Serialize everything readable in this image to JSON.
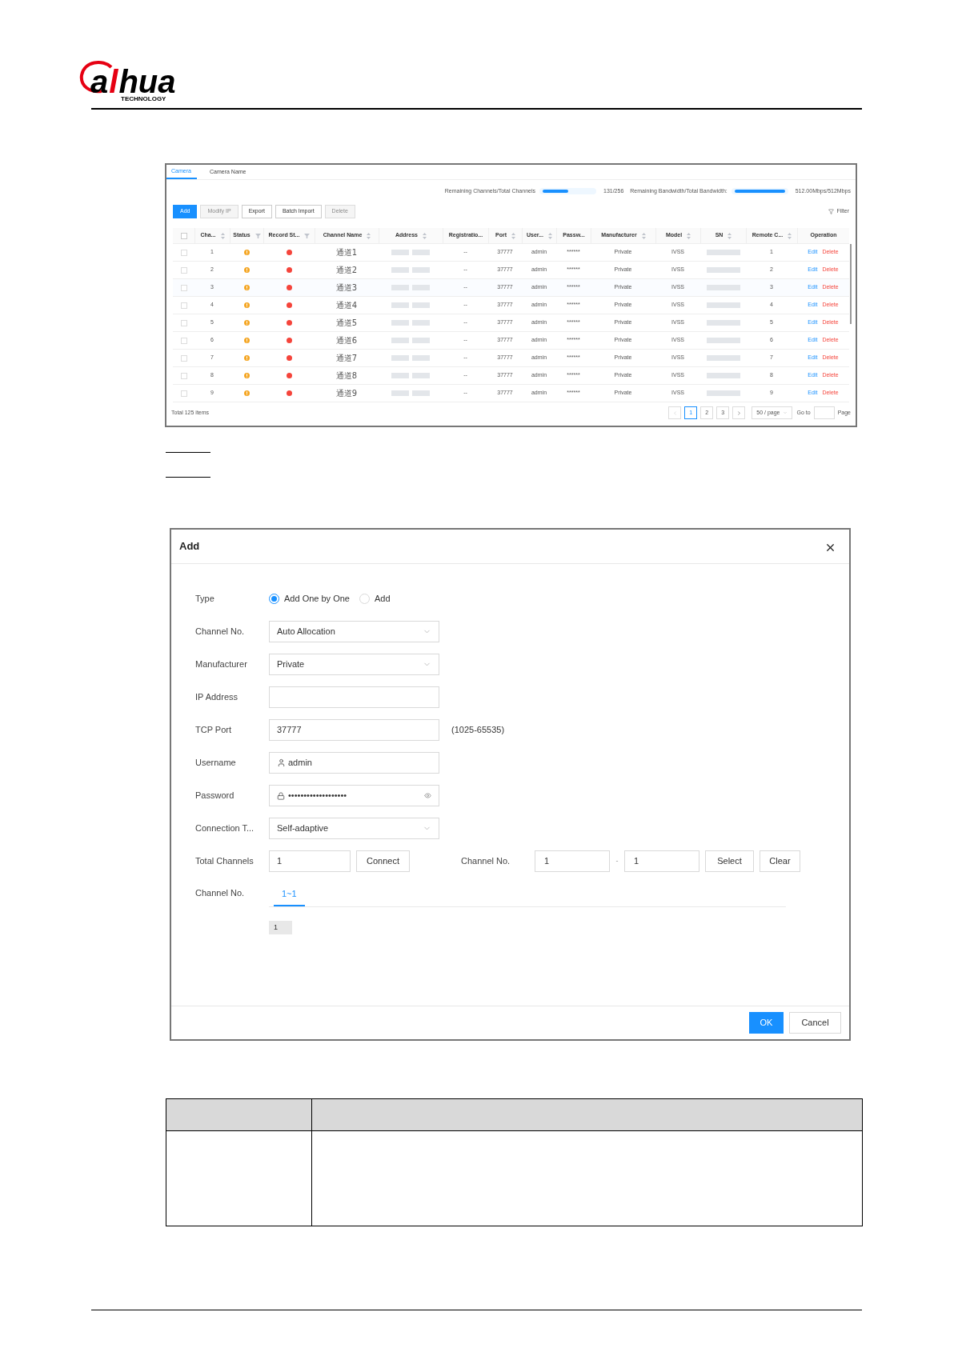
{
  "logo": {
    "parts": [
      {
        "text": "a",
        "kind": "ring"
      },
      {
        "text": "l",
        "kind": "slash"
      },
      {
        "text": "hua",
        "kind": "plain"
      }
    ],
    "tagline": "TECHNOLOGY"
  },
  "camera_screen": {
    "tabs": [
      {
        "label": "Camera",
        "selected": true
      },
      {
        "label": "Camera Name",
        "selected": false
      }
    ],
    "meters": [
      {
        "label": "Remaining Channels/Total Channels",
        "level": 0.51,
        "reading": "131/256"
      },
      {
        "label": "Remaining Bandwidth/Total Bandwidth:",
        "level": 1,
        "reading": "512.00Mbps/512Mbps"
      }
    ],
    "toolbar": [
      {
        "label": "Add",
        "kind": "primary",
        "disabled": false
      },
      {
        "label": "Modify IP",
        "kind": "default",
        "disabled": true
      },
      {
        "label": "Export",
        "kind": "default",
        "disabled": false
      },
      {
        "label": "Batch Import",
        "kind": "default",
        "disabled": false
      },
      {
        "label": "Delete",
        "kind": "default",
        "disabled": true
      }
    ],
    "filter": "Filter",
    "table": {
      "select_all": false,
      "columns": [
        {
          "label": "Cha...",
          "kind": "sort"
        },
        {
          "label": "Status",
          "kind": "filter"
        },
        {
          "label": "Record St...",
          "kind": "filter"
        },
        {
          "label": "Channel Name",
          "kind": "sort"
        },
        {
          "label": "Address",
          "kind": "sort"
        },
        {
          "label": "Registratio...",
          "kind": "none"
        },
        {
          "label": "Port",
          "kind": "sort"
        },
        {
          "label": "User...",
          "kind": "sort"
        },
        {
          "label": "Passw...",
          "kind": "none"
        },
        {
          "label": "Manufacturer",
          "kind": "sort"
        },
        {
          "label": "Model",
          "kind": "sort"
        },
        {
          "label": "SN",
          "kind": "sort"
        },
        {
          "label": "Remote C...",
          "kind": "sort"
        },
        {
          "label": "Operation",
          "kind": "none"
        }
      ],
      "rows": [
        {
          "checked": false,
          "channel": "1",
          "name": "通道1",
          "registration": "--",
          "port": "37777",
          "user": "admin",
          "password": "******",
          "manufacturer": "Private",
          "model": "IVSS",
          "remote": "1",
          "actions": [
            {
              "label": "Edit",
              "kind": "edit"
            },
            {
              "label": "Delete",
              "kind": "delete"
            }
          ]
        },
        {
          "checked": false,
          "channel": "2",
          "name": "通道2",
          "registration": "--",
          "port": "37777",
          "user": "admin",
          "password": "******",
          "manufacturer": "Private",
          "model": "IVSS",
          "remote": "2",
          "actions": [
            {
              "label": "Edit",
              "kind": "edit"
            },
            {
              "label": "Delete",
              "kind": "delete"
            }
          ]
        },
        {
          "checked": false,
          "channel": "3",
          "name": "通道3",
          "registration": "--",
          "port": "37777",
          "user": "admin",
          "password": "******",
          "manufacturer": "Private",
          "model": "IVSS",
          "remote": "3",
          "actions": [
            {
              "label": "Edit",
              "kind": "edit"
            },
            {
              "label": "Delete",
              "kind": "delete"
            }
          ]
        },
        {
          "checked": false,
          "channel": "4",
          "name": "通道4",
          "registration": "--",
          "port": "37777",
          "user": "admin",
          "password": "******",
          "manufacturer": "Private",
          "model": "IVSS",
          "remote": "4",
          "actions": [
            {
              "label": "Edit",
              "kind": "edit"
            },
            {
              "label": "Delete",
              "kind": "delete"
            }
          ]
        },
        {
          "checked": false,
          "channel": "5",
          "name": "通道5",
          "registration": "--",
          "port": "37777",
          "user": "admin",
          "password": "******",
          "manufacturer": "Private",
          "model": "IVSS",
          "remote": "5",
          "actions": [
            {
              "label": "Edit",
              "kind": "edit"
            },
            {
              "label": "Delete",
              "kind": "delete"
            }
          ]
        },
        {
          "checked": false,
          "channel": "6",
          "name": "通道6",
          "registration": "--",
          "port": "37777",
          "user": "admin",
          "password": "******",
          "manufacturer": "Private",
          "model": "IVSS",
          "remote": "6",
          "actions": [
            {
              "label": "Edit",
              "kind": "edit"
            },
            {
              "label": "Delete",
              "kind": "delete"
            }
          ]
        },
        {
          "checked": false,
          "channel": "7",
          "name": "通道7",
          "registration": "--",
          "port": "37777",
          "user": "admin",
          "password": "******",
          "manufacturer": "Private",
          "model": "IVSS",
          "remote": "7",
          "actions": [
            {
              "label": "Edit",
              "kind": "edit"
            },
            {
              "label": "Delete",
              "kind": "delete"
            }
          ]
        },
        {
          "checked": false,
          "channel": "8",
          "name": "通道8",
          "registration": "--",
          "port": "37777",
          "user": "admin",
          "password": "******",
          "manufacturer": "Private",
          "model": "IVSS",
          "remote": "8",
          "actions": [
            {
              "label": "Edit",
              "kind": "edit"
            },
            {
              "label": "Delete",
              "kind": "delete"
            }
          ]
        },
        {
          "checked": false,
          "channel": "9",
          "name": "通道9",
          "registration": "--",
          "port": "37777",
          "user": "admin",
          "password": "******",
          "manufacturer": "Private",
          "model": "IVSS",
          "remote": "9",
          "actions": [
            {
              "label": "Edit",
              "kind": "edit"
            },
            {
              "label": "Delete",
              "kind": "delete"
            }
          ]
        }
      ]
    },
    "total": "Total 125 items",
    "pagination": {
      "prev_disabled": true,
      "pages": [
        {
          "label": "1",
          "selected": true
        },
        {
          "label": "2",
          "selected": false
        },
        {
          "label": "3",
          "selected": false
        }
      ],
      "page_size": "50 / page",
      "goto_label": "Go to",
      "page_label": "Page"
    }
  },
  "add_dialog": {
    "title": "Add",
    "fields": [
      {
        "label": "Type",
        "kind": "radio",
        "options": [
          {
            "label": "Add One by One",
            "selected": true
          },
          {
            "label": "Add",
            "selected": false
          }
        ]
      },
      {
        "label": "Channel No.",
        "kind": "select",
        "value": "Auto Allocation"
      },
      {
        "label": "Manufacturer",
        "kind": "select",
        "value": "Private"
      },
      {
        "label": "IP Address",
        "kind": "text"
      },
      {
        "label": "TCP Port",
        "kind": "text",
        "value": "37777",
        "hint": "(1025-65535)"
      },
      {
        "label": "Username",
        "kind": "user",
        "value": "admin"
      },
      {
        "label": "Password",
        "kind": "password",
        "value": "•••••••••••••••••••"
      },
      {
        "label": "Connection T...",
        "kind": "select",
        "value": "Self-adaptive"
      }
    ],
    "channels_row": {
      "label": "Total Channels",
      "value": "1",
      "connect": "Connect",
      "range_label": "Channel No.",
      "from": "1",
      "separator": "-",
      "to": "1",
      "select": "Select",
      "clear": "Clear"
    },
    "channel_tabs": {
      "label": "Channel No.",
      "tabs": [
        {
          "label": "1~1",
          "selected": true
        }
      ],
      "chips": [
        "1"
      ]
    },
    "buttons": [
      {
        "label": "OK",
        "kind": "primary"
      },
      {
        "label": "Cancel",
        "kind": "default"
      }
    ]
  }
}
